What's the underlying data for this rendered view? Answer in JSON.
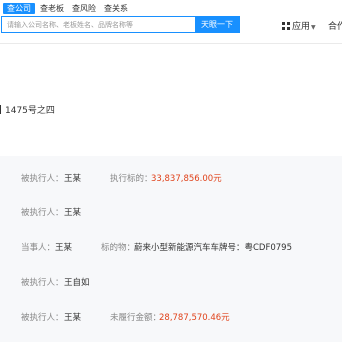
{
  "header": {
    "tabs": [
      {
        "label": "查公司",
        "active": true
      },
      {
        "label": "查老板",
        "active": false
      },
      {
        "label": "查风险",
        "active": false
      },
      {
        "label": "查关系",
        "active": false
      }
    ],
    "search": {
      "placeholder": "请输入公司名称、老板姓名、品牌名称等",
      "value": ""
    },
    "search_button": "天眼一下",
    "apps_label": "应用",
    "coop_label": "合作"
  },
  "address_fragment": "1475号之四",
  "records": [
    {
      "label": "被执行人：",
      "name": "王某",
      "field_label": "执行标的：",
      "field_value": "33,837,856.00元"
    },
    {
      "label": "被执行人：",
      "name": "王某"
    },
    {
      "label": "当事人：",
      "name": "王某",
      "field_label": "标的物：",
      "field_value": "蔚来小型新能源汽车车牌号：粤CDF0795"
    },
    {
      "label": "被执行人：",
      "name": "王自如"
    },
    {
      "label": "被执行人：",
      "name": "王某",
      "field_label": "未履行金额：",
      "field_value": "28,787,570.46元"
    }
  ],
  "colors": {
    "accent": "#1890ff",
    "amount": "#e0421a",
    "panel_bg": "#f7f8fa"
  }
}
